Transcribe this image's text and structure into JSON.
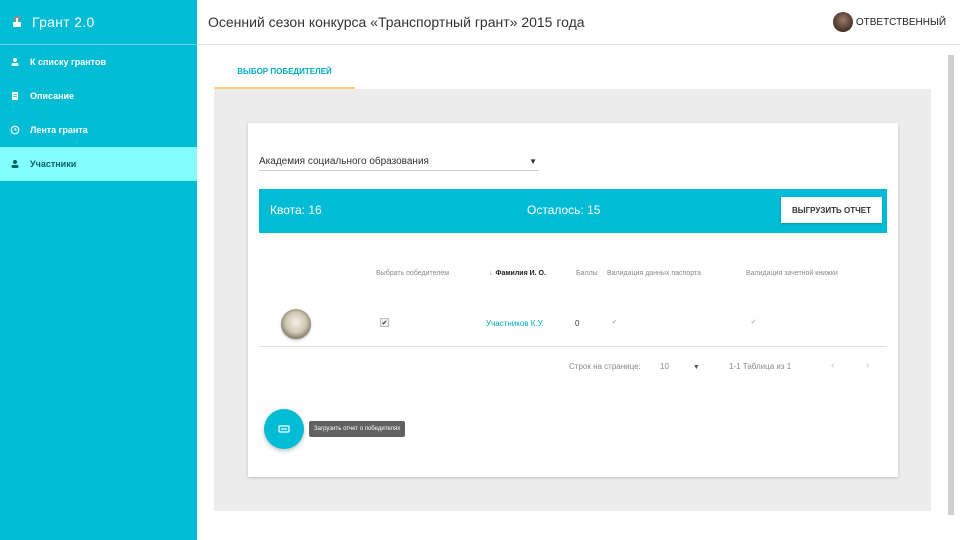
{
  "app": {
    "title": "Грант 2.0"
  },
  "sidebar": {
    "items": [
      {
        "label": "К списку грантов",
        "icon": "person-upload-icon",
        "active": false
      },
      {
        "label": "Описание",
        "icon": "document-icon",
        "active": false
      },
      {
        "label": "Лента гранта",
        "icon": "clock-icon",
        "active": false
      },
      {
        "label": "Участники",
        "icon": "person-icon",
        "active": true
      }
    ]
  },
  "header": {
    "title": "Осенний сезон конкурса «Транспортный грант» 2015 года",
    "user_label": "ОТВЕТСТВЕННЫЙ"
  },
  "tabs": [
    {
      "label": "ВЫБОР ПОБЕДИТЕЛЕЙ",
      "active": true
    }
  ],
  "card": {
    "organization": {
      "selected": "Академия социального образования"
    },
    "quota": {
      "quota_label": "Квота: 16",
      "remaining_label": "Осталось: 15",
      "export_label": "ВЫГРУЗИТЬ ОТЧЕТ"
    },
    "table": {
      "columns": [
        "Выбрать победителем",
        "Фамилия И. О.",
        "Баллы",
        "Валидация данных паспорта",
        "Валидация зачетной книжки"
      ],
      "sort_arrow": "↓",
      "rows": [
        {
          "winner": true,
          "name": "Участников К.У.",
          "score": "0",
          "passport_valid": true,
          "record_book_valid": true
        }
      ]
    },
    "pagination": {
      "rows_per_page_label": "Строк на странице:",
      "rows_per_page_value": "10",
      "range_label": "1-1 Таблица из 1",
      "prev_icon": "‹",
      "next_icon": "›"
    },
    "fab_tooltip": "Загрузить отчет о победителях"
  },
  "colors": {
    "accent": "#00bcd4",
    "active_nav": "#84ffff",
    "tab_underline": "#ffcc80"
  }
}
